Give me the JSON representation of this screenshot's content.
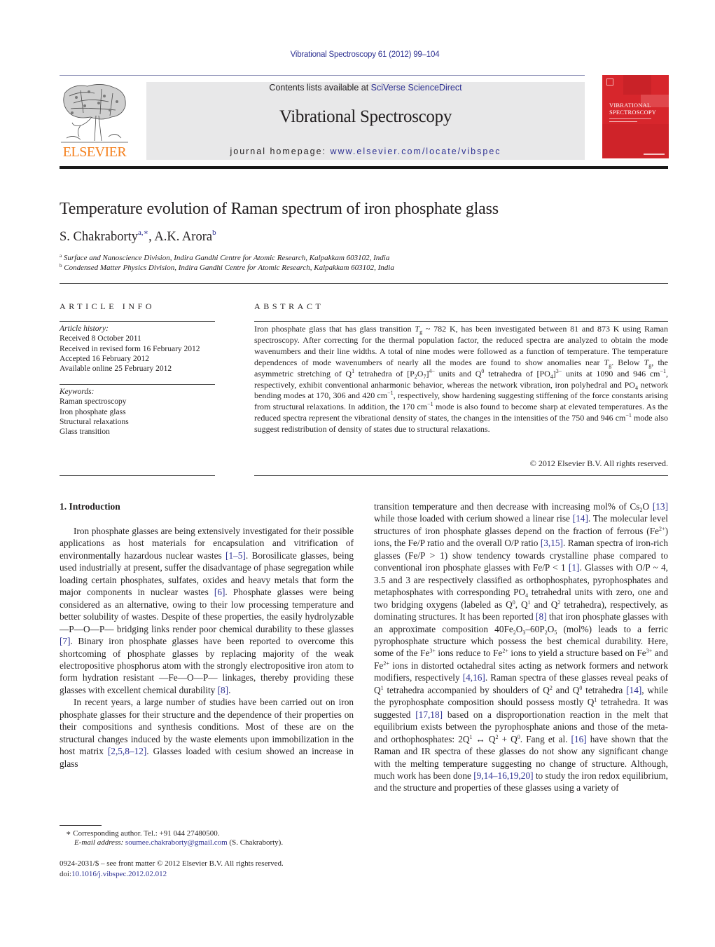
{
  "header": {
    "journal_ref": "Vibrational Spectroscopy 61 (2012) 99–104",
    "contents_prefix": "Contents lists available at ",
    "contents_link": "SciVerse ScienceDirect",
    "journal_title": "Vibrational Spectroscopy",
    "homepage_prefix": "journal homepage: ",
    "homepage_link": "www.elsevier.com/locate/vibspec",
    "publisher_logo_text": "ELSEVIER",
    "cover": {
      "title_line1": "VIBRATIONAL",
      "title_line2": "SPECTROSCOPY"
    },
    "colors": {
      "link": "#2e3192",
      "elsevier_orange": "#f5811f",
      "cover_red": "#d7262c",
      "banner_gray": "#e8e8e9"
    }
  },
  "article": {
    "title": "Temperature evolution of Raman spectrum of iron phosphate glass",
    "authors": [
      {
        "name": "S. Chakraborty",
        "marks": "a,∗"
      },
      {
        "name": "A.K. Arora",
        "marks": "b"
      }
    ],
    "author_separator": ", ",
    "affiliations": [
      {
        "mark": "a",
        "text": "Surface and Nanoscience Division, Indira Gandhi Centre for Atomic Research, Kalpakkam 603102, India"
      },
      {
        "mark": "b",
        "text": "Condensed Matter Physics Division, Indira Gandhi Centre for Atomic Research, Kalpakkam 603102, India"
      }
    ]
  },
  "article_info": {
    "heading": "ARTICLE INFO",
    "history_label": "Article history:",
    "history": [
      "Received 8 October 2011",
      "Received in revised form 16 February 2012",
      "Accepted 16 February 2012",
      "Available online 25 February 2012"
    ],
    "keywords_label": "Keywords:",
    "keywords": [
      "Raman spectroscopy",
      "Iron phosphate glass",
      "Structural relaxations",
      "Glass transition"
    ]
  },
  "abstract": {
    "heading": "ABSTRACT",
    "t1": "Iron phosphate glass that has glass transition ",
    "tg": "T",
    "tg_sub": "g",
    "t2": " ~ 782 K, has been investigated between 81 and 873 K using Raman spectroscopy. After correcting for the thermal population factor, the reduced spectra are analyzed to obtain the mode wavenumbers and their line widths. A total of nine modes were followed as a function of temperature. The temperature dependences of mode wavenumbers of nearly all the modes are found to show anomalies near ",
    "t3": ". Below ",
    "t4": ", the asymmetric stretching of Q",
    "sup1": "1",
    "t5": " tetrahedra of [P",
    "sub2": "2",
    "t6": "O",
    "sub7": "7",
    "t7": "]",
    "sup4": "4−",
    "t8": " units and Q",
    "sup0": "0",
    "t9": " tetrahedra of [PO",
    "sub4": "4",
    "t10": "]",
    "sup3": "3−",
    "t11": " units at 1090 and 946 cm",
    "supm1": "−1",
    "t12": ", respectively, exhibit conventional anharmonic behavior, whereas the network vibration, iron polyhedral and PO",
    "t13": " network bending modes at 170, 306 and 420 cm",
    "t14": ", respectively, show hardening suggesting stiffening of the force constants arising from structural relaxations. In addition, the 170 cm",
    "t15": " mode is also found to become sharp at elevated temperatures. As the reduced spectra represent the vibrational density of states, the changes in the intensities of the 750 and 946 cm",
    "t16": " mode also suggest redistribution of density of states due to structural relaxations.",
    "copyright": "© 2012 Elsevier B.V. All rights reserved."
  },
  "body": {
    "section_heading": "1.  Introduction",
    "p1": {
      "a": "Iron phosphate glasses are being extensively investigated for their possible applications as host materials for encapsulation and vitrification of environmentally hazardous nuclear wastes ",
      "r1": "[1–5]",
      "b": ". Borosilicate glasses, being used industrially at present, suffer the disadvantage of phase segregation while loading certain phosphates, sulfates, oxides and heavy metals that form the major components in nuclear wastes ",
      "r2": "[6]",
      "c": ". Phosphate glasses were being considered as an alternative, owing to their low processing temperature and better solubility of wastes. Despite of these properties, the easily hydrolyzable —P—O—P— bridging links render poor chemical durability to these glasses ",
      "r3": "[7]",
      "d": ". Binary iron phosphate glasses have been reported to overcome this shortcoming of phosphate glasses by replacing majority of the weak electropositive phosphorus atom with the strongly electropositive iron atom to form hydration resistant —Fe—O—P— linkages, thereby providing these glasses with excellent chemical durability ",
      "r4": "[8]",
      "e": "."
    },
    "p2": {
      "a": "In recent years, a large number of studies have been carried out on iron phosphate glasses for their structure and the dependence of their properties on their compositions and synthesis conditions. Most of these are on the structural changes induced by the waste elements upon immobilization in the host matrix ",
      "r1": "[2,5,8–12]",
      "b": ". Glasses loaded with cesium showed an increase in glass transition temperature and then decrease with increasing mol% of Cs",
      "sub2": "2",
      "c": "O ",
      "r2": "[13]",
      "d": " while those loaded with cerium showed a linear rise ",
      "r3": "[14]",
      "e": ". The molecular level structures of iron phosphate glasses depend on the fraction of ferrous (Fe",
      "sup2p": "2+",
      "f": ") ions, the Fe/P ratio and the overall O/P ratio ",
      "r4": "[3,15]",
      "g": ". Raman spectra of iron-rich glasses (Fe/P > 1) show tendency towards crystalline phase compared to conventional iron phosphate glasses with Fe/P < 1 ",
      "r5": "[1]",
      "h": ". Glasses with O/P ~ 4, 3.5 and 3 are respectively classified as orthophosphates, pyrophosphates and metaphosphates with corresponding PO",
      "sub4": "4",
      "i": " tetrahedral units with zero, one and two bridging oxygens (labeled as Q",
      "sup0": "0",
      "j": ", Q",
      "sup1": "1",
      "k": " and Q",
      "sup2": "2",
      "l": " tetrahedra), respectively, as dominating structures. It has been reported ",
      "r6": "[8]",
      "m": " that iron phosphate glasses with an approximate composition 40Fe",
      "sub3": "3",
      "n": "O",
      "o": "–60P",
      "sub5": "5",
      "p": " (mol%) leads to a ferric pyrophosphate structure which possess the best chemical durability. Here, some of the Fe",
      "sup3p": "3+",
      "q": " ions reduce to Fe",
      "r": " ions to yield a structure based on Fe",
      "s": " and Fe",
      "t": " ions in distorted octahedral sites acting as network formers and network modifiers, respectively ",
      "r7": "[4,16]",
      "u": ". Raman spectra of these glasses reveal peaks of Q",
      "v": " tetrahedra accompanied by shoulders of Q",
      "w": " tetrahedra ",
      "r8": "[14]",
      "x": ", while the pyrophosphate composition should possess mostly Q",
      "y": " tetrahedra. It was suggested ",
      "r9": "[17,18]",
      "z": " based on a disproportionation reaction in the melt that equilibrium exists between the pyrophosphate anions and those of the meta- and orthophosphates: 2Q",
      "arrow": " ↔ Q",
      "plus": " + Q",
      "aa": ". Fang et al. ",
      "r10": "[16]",
      "ab": " have shown that the Raman and IR spectra of these glasses do not show any significant change with the melting temperature suggesting no change of structure. Although, much work has been done ",
      "r11": "[9,14–16,19,20]",
      "ac": " to study the iron redox equilibrium, and the structure and properties of these glasses using a variety of"
    },
    "and_word": " and Q"
  },
  "footnotes": {
    "star": "∗",
    "corresponding": " Corresponding author. Tel.: +91 044 27480500.",
    "email_label": "E-mail address:",
    "email": "soumee.chakraborty@gmail.com",
    "email_suffix": " (S. Chakraborty).",
    "issn": "0924-2031/$ – see front matter © 2012 Elsevier B.V. All rights reserved.",
    "doi_prefix": "doi:",
    "doi": "10.1016/j.vibspec.2012.02.012"
  }
}
